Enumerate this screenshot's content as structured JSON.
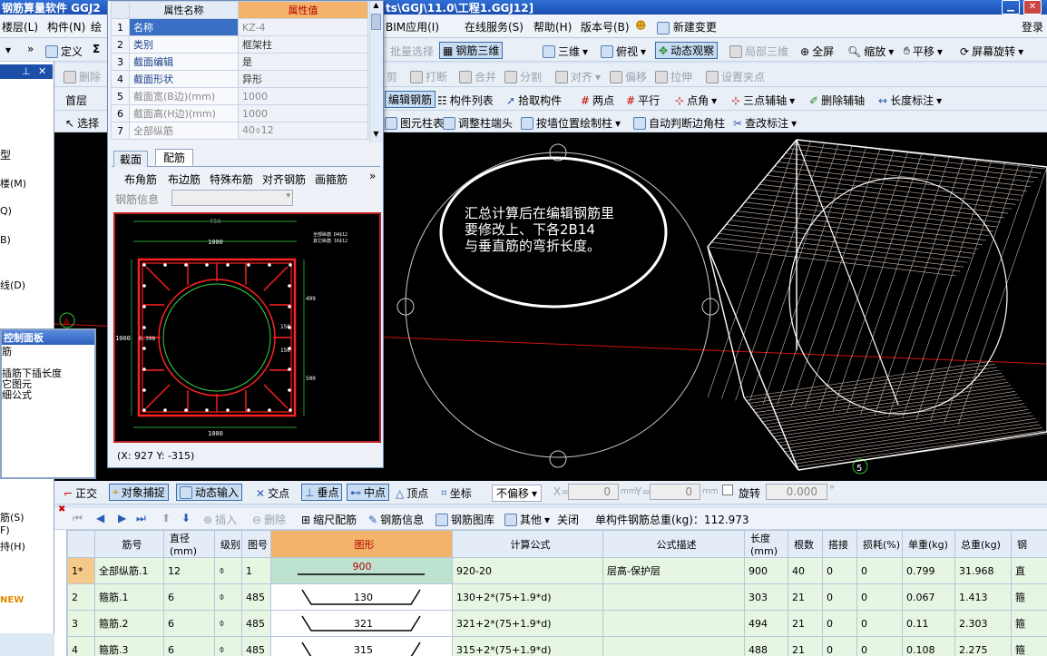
{
  "title": {
    "left": "钢筋算量软件 GGJ2",
    "right": "ts\\GGJ\\11.0\\工程1.GGJ12]"
  },
  "menu": [
    "楼层(L)",
    "构件(N)",
    "绘",
    "BIM应用(I)",
    "在线服务(S)",
    "帮助(H)",
    "版本号(B)",
    "新建变更",
    "登录"
  ],
  "toolbar1": {
    "define": "定义",
    "sigma": "Σ",
    "batch_select": "批量选择",
    "rebar_3d": "钢筋三维",
    "view_3d": "三维",
    "top_view": "俯视",
    "dynamic_view": "动态观察",
    "partial_3d": "局部三维",
    "fullscreen": "全屏",
    "zoom": "缩放",
    "pan": "平移",
    "screen_rotate": "屏幕旋转"
  },
  "toolbar2": {
    "delete": "删除",
    "cut": "剪",
    "break": "打断",
    "merge": "合并",
    "split": "分割",
    "align": "对齐",
    "offset": "偏移",
    "stretch": "拉伸",
    "set_grip": "设置夹点"
  },
  "toolbar3": {
    "floor": "首层",
    "edit_rebar": "编辑钢筋",
    "component_list": "构件列表",
    "pick_component": "拾取构件",
    "two_points": "两点",
    "parallel": "平行",
    "point_angle": "点角",
    "three_point_axis": "三点辅轴",
    "delete_axis": "删除辅轴",
    "length_dim": "长度标注"
  },
  "toolbar4": {
    "select": "选择",
    "column_table": "图元柱表",
    "adjust_column_end": "调整柱端头",
    "draw_by_wall": "按墙位置绘制柱",
    "auto_corner_column": "自动判断边角柱",
    "modify_label": "查改标注"
  },
  "left_panel": {
    "header": "",
    "items": [
      "型",
      "楼(M)",
      "Q)",
      "B)",
      "线(D)",
      "筋(S)",
      "F)",
      "持(H)",
      "NEW"
    ]
  },
  "control_panel": {
    "title": "控制面板",
    "lines": [
      "筋",
      "插筋下插长度",
      "它图元",
      "细公式"
    ]
  },
  "property_dialog": {
    "col_name": "属性名称",
    "col_value": "属性值",
    "rows": [
      {
        "no": "1",
        "name": "名称",
        "value": "KZ-4"
      },
      {
        "no": "2",
        "name": "类别",
        "value": "框架柱"
      },
      {
        "no": "3",
        "name": "截面编辑",
        "value": "是"
      },
      {
        "no": "4",
        "name": "截面形状",
        "value": "异形"
      },
      {
        "no": "5",
        "name": "截面宽(B边)(mm)",
        "value": "1000"
      },
      {
        "no": "6",
        "name": "截面高(H边)(mm)",
        "value": "1000"
      },
      {
        "no": "7",
        "name": "全部纵筋",
        "value": "40⌽12"
      }
    ],
    "tabs": [
      "截面",
      "配筋"
    ],
    "rebar_tools": [
      "布角筋",
      "布边筋",
      "特殊布筋",
      "对齐钢筋",
      "画箍筋"
    ],
    "rebar_info_label": "钢筋信息",
    "section_labels": {
      "top": "1000",
      "bottom": "1000",
      "left": "1000",
      "top2": "T50",
      "r1": "499",
      "r2": "150",
      "r3": "150",
      "r4": "500",
      "mid": "0.398",
      "legend1": "全部纵筋 D4⌽12",
      "legend2": "其它纵筋 16⌽12"
    },
    "coords": "(X: 927 Y: -315)"
  },
  "canvas": {
    "annotation": [
      "汇总计算后在编辑钢筋里",
      "要修改上、下各2B14",
      "与垂直筋的弯折长度。"
    ],
    "marker_a": "A",
    "marker_5": "5"
  },
  "snap_bar": {
    "ortho": "正交",
    "object_snap": "对象捕捉",
    "dynamic_input": "动态输入",
    "intersection": "交点",
    "perpendicular": "垂点",
    "midpoint": "中点",
    "vertex": "顶点",
    "coordinate": "坐标",
    "offset_mode": "不偏移",
    "x_label": "X=",
    "x_value": "0",
    "y_label": "Y=",
    "y_value": "0",
    "mm": "mm",
    "rotate": "旋转",
    "rotate_value": "0.000",
    "degree": "°"
  },
  "grid_toolbar": {
    "insert": "插入",
    "delete": "删除",
    "scale_rebar": "缩尺配筋",
    "rebar_info": "钢筋信息",
    "rebar_library": "钢筋图库",
    "other": "其他",
    "close": "关闭",
    "total_weight": "单构件钢筋总重(kg)：112.973"
  },
  "grid": {
    "columns": [
      "筋号",
      "直径(mm)",
      "级别",
      "图号",
      "图形",
      "计算公式",
      "公式描述",
      "长度(mm)",
      "根数",
      "搭接",
      "损耗(%)",
      "单重(kg)",
      "总重(kg)",
      "钢"
    ],
    "rows": [
      {
        "rownum": "1*",
        "name": "全部纵筋.1",
        "dia": "12",
        "grade": "⌽",
        "fig": "1",
        "shape": "900",
        "formula": "920-20",
        "desc": "层高-保护层",
        "length": "900",
        "count": "40",
        "lap": "0",
        "loss": "0",
        "unit": "0.799",
        "total": "31.968",
        "type": "直"
      },
      {
        "rownum": "2",
        "name": "箍筋.1",
        "dia": "6",
        "grade": "⌽",
        "fig": "485",
        "shape": "130",
        "formula": "130+2*(75+1.9*d)",
        "desc": "",
        "length": "303",
        "count": "21",
        "lap": "0",
        "loss": "0",
        "unit": "0.067",
        "total": "1.413",
        "type": "箍"
      },
      {
        "rownum": "3",
        "name": "箍筋.2",
        "dia": "6",
        "grade": "⌽",
        "fig": "485",
        "shape": "321",
        "formula": "321+2*(75+1.9*d)",
        "desc": "",
        "length": "494",
        "count": "21",
        "lap": "0",
        "loss": "0",
        "unit": "0.11",
        "total": "2.303",
        "type": "箍"
      },
      {
        "rownum": "4",
        "name": "箍筋.3",
        "dia": "6",
        "grade": "⌽",
        "fig": "485",
        "shape": "315",
        "formula": "315+2*(75+1.9*d)",
        "desc": "",
        "length": "488",
        "count": "21",
        "lap": "0",
        "loss": "0",
        "unit": "0.108",
        "total": "2.275",
        "type": "箍"
      }
    ]
  },
  "colors": {
    "canvas_bg": "#000000",
    "rebar_red": "#ff2020",
    "rebar_green": "#39d24a",
    "highlight_header": "#f4b36a",
    "row_green": "#e6f6e2"
  }
}
